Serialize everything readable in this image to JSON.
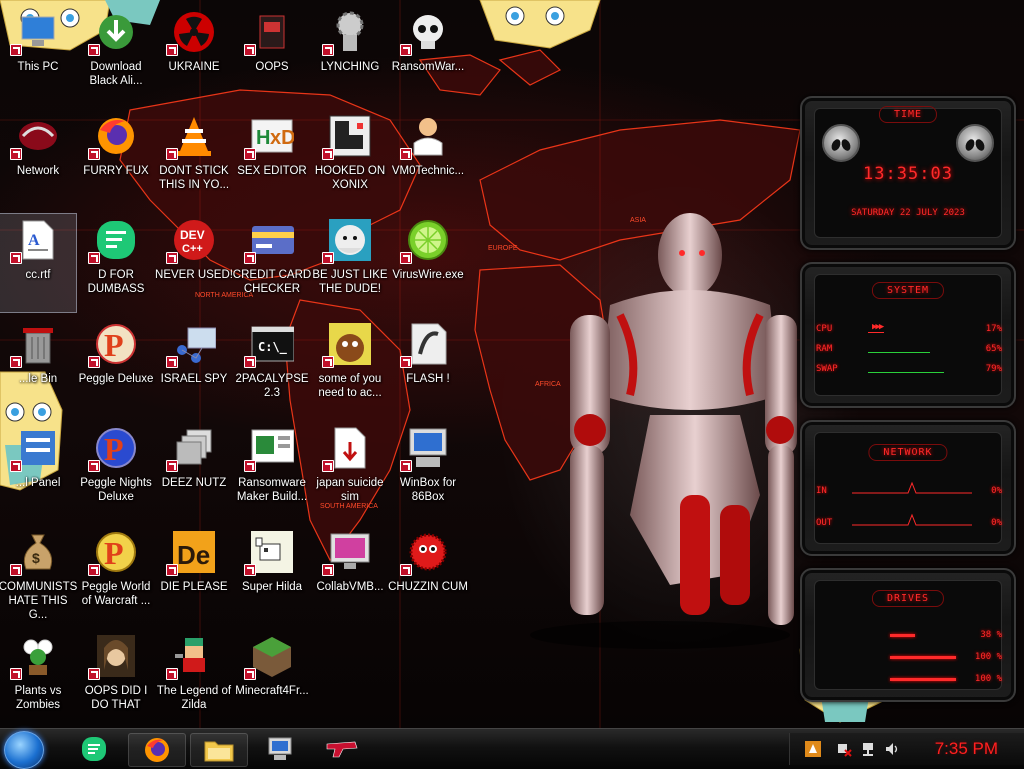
{
  "desktop_icons": [
    {
      "label": "This PC",
      "icon": "computer-icon"
    },
    {
      "label": "Download Black Ali...",
      "icon": "download-icon"
    },
    {
      "label": "UKRAINE",
      "icon": "radiation-icon"
    },
    {
      "label": "OOPS",
      "icon": "book-icon"
    },
    {
      "label": "LYNCHING",
      "icon": "gear-figure-icon"
    },
    {
      "label": "RansomWar...",
      "icon": "skull-icon"
    },
    {
      "label": "Network",
      "icon": "network-icon"
    },
    {
      "label": "FURRY FUX",
      "icon": "firefox-icon"
    },
    {
      "label": "DONT STICK THIS IN YO...",
      "icon": "vlc-cone-icon"
    },
    {
      "label": "SEX EDITOR",
      "icon": "hxd-icon"
    },
    {
      "label": "HOOKED ON XONIX",
      "icon": "xonix-icon"
    },
    {
      "label": "VM0Technic...",
      "icon": "doctor-icon"
    },
    {
      "label": "cc.rtf",
      "icon": "rtf-document-icon"
    },
    {
      "label": "D FOR DUMBASS",
      "icon": "chat-app-icon"
    },
    {
      "label": "NEVER USED!",
      "icon": "devcpp-icon"
    },
    {
      "label": "CREDIT CARD CHECKER",
      "icon": "credit-card-icon"
    },
    {
      "label": "BE JUST LIKE THE DUDE!",
      "icon": "globe-man-icon"
    },
    {
      "label": "VirusWire.exe",
      "icon": "lime-icon"
    },
    {
      "label": "...le Bin",
      "icon": "recycle-bin-icon"
    },
    {
      "label": "Peggle Deluxe",
      "icon": "peggle-icon"
    },
    {
      "label": "ISRAEL SPY",
      "icon": "spy-network-icon"
    },
    {
      "label": "2PACALYPSE 2.3",
      "icon": "terminal-icon"
    },
    {
      "label": "some of you need to ac...",
      "icon": "beaver-icon"
    },
    {
      "label": "FLASH !",
      "icon": "flash-player-icon"
    },
    {
      "label": "...l Panel",
      "icon": "control-panel-icon"
    },
    {
      "label": "Peggle Nights Deluxe",
      "icon": "peggle-nights-icon"
    },
    {
      "label": "DEEZ NUTZ",
      "icon": "windows-stack-icon"
    },
    {
      "label": "Ransomware Maker Build...",
      "icon": "ransomware-builder-icon"
    },
    {
      "label": "japan suicide sim",
      "icon": "download-document-icon"
    },
    {
      "label": "WinBox for 86Box",
      "icon": "winbox-icon"
    },
    {
      "label": "COMMUNISTS HATE THIS G...",
      "icon": "money-bag-icon"
    },
    {
      "label": "Peggle World of Warcraft ...",
      "icon": "peggle-wow-icon"
    },
    {
      "label": "DIE PLEASE",
      "icon": "adobe-de-icon"
    },
    {
      "label": "Super Hilda",
      "icon": "pixel-dog-icon"
    },
    {
      "label": "CollabVMB...",
      "icon": "monitor-icon"
    },
    {
      "label": "CHUZZIN CUM",
      "icon": "chuzzle-icon"
    },
    {
      "label": "Plants vs Zombies",
      "icon": "plant-icon"
    },
    {
      "label": "OOPS DID I DO THAT",
      "icon": "portrait-icon"
    },
    {
      "label": "The Legend of Zilda",
      "icon": "pixel-hero-icon"
    },
    {
      "label": "Minecraft4Fr...",
      "icon": "grass-block-icon"
    }
  ],
  "map_labels": [
    "NORTH AMERICA",
    "EUROPE",
    "AFRICA",
    "SOUTH AMERICA",
    "ASIA"
  ],
  "gadgets": {
    "time": {
      "title": "TIME",
      "clock": "13:35:03",
      "date": "SATURDAY 22 JULY 2023"
    },
    "system": {
      "title": "SYSTEM",
      "rows": [
        {
          "label": "CPU",
          "value": "17%",
          "level": 0.17
        },
        {
          "label": "RAM",
          "value": "65%",
          "level": 0.65
        },
        {
          "label": "SWAP",
          "value": "79%",
          "level": 0.79
        }
      ]
    },
    "network": {
      "title": "NETWORK",
      "rows": [
        {
          "label": "IN",
          "value": "0%"
        },
        {
          "label": "OUT",
          "value": "0%"
        }
      ]
    },
    "drives": {
      "title": "DRIVES",
      "rows": [
        {
          "value": "38 %",
          "level": 0.38
        },
        {
          "value": "100 %",
          "level": 1.0
        },
        {
          "value": "100 %",
          "level": 1.0
        }
      ]
    }
  },
  "taskbar": {
    "pinned": [
      {
        "name": "chat-app",
        "icon": "chat-app-icon"
      },
      {
        "name": "firefox",
        "icon": "firefox-icon"
      },
      {
        "name": "file-explorer",
        "icon": "folder-icon"
      },
      {
        "name": "winbox",
        "icon": "winbox-icon"
      },
      {
        "name": "gun-app",
        "icon": "gun-icon"
      }
    ],
    "tray_icons": [
      "tray-app-icon",
      "network-error-icon",
      "network-icon",
      "volume-icon"
    ],
    "clock": "7:35 PM"
  },
  "colors": {
    "accent_red": "#ff2a2a",
    "taskbar_clock": "#ff2020",
    "start_orb": "#1a6fd0"
  }
}
